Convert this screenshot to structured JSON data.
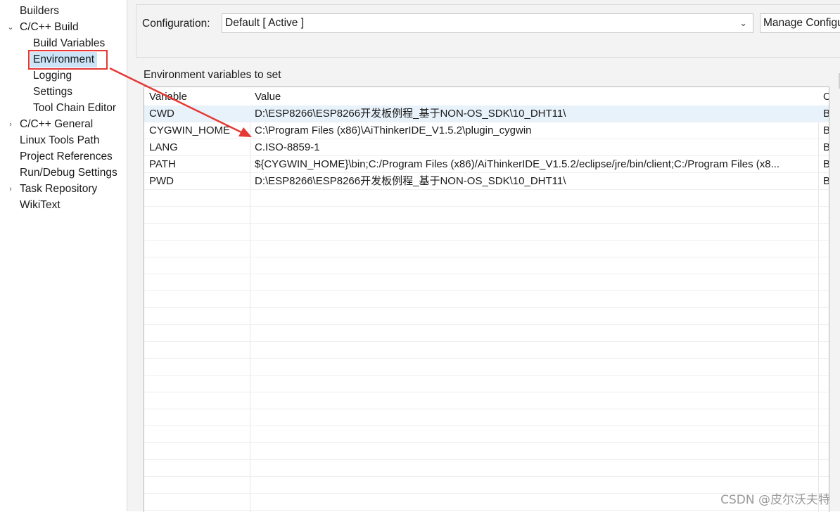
{
  "sidebar": {
    "items": [
      {
        "label": "Builders",
        "twisty": ""
      },
      {
        "label": "C/C++ Build",
        "twisty": "⌄"
      },
      {
        "label": "Build Variables",
        "twisty": ""
      },
      {
        "label": "Environment",
        "twisty": ""
      },
      {
        "label": "Logging",
        "twisty": ""
      },
      {
        "label": "Settings",
        "twisty": ""
      },
      {
        "label": "Tool Chain Editor",
        "twisty": ""
      },
      {
        "label": "C/C++ General",
        "twisty": "›"
      },
      {
        "label": "Linux Tools Path",
        "twisty": ""
      },
      {
        "label": "Project References",
        "twisty": ""
      },
      {
        "label": "Run/Debug Settings",
        "twisty": ""
      },
      {
        "label": "Task Repository",
        "twisty": "›"
      },
      {
        "label": "WikiText",
        "twisty": ""
      }
    ],
    "selected": "Environment"
  },
  "config": {
    "label": "Configuration:",
    "value": "Default  [ Active ]",
    "manage_button": "Manage Configurations..."
  },
  "env": {
    "section_label": "Environment variables to set",
    "columns": [
      "Variable",
      "Value",
      "Origin"
    ],
    "rows": [
      {
        "variable": "CWD",
        "value": "D:\\ESP8266\\ESP8266开发板例程_基于NON-OS_SDK\\10_DHT11\\",
        "origin": "BUILD SYSTEM"
      },
      {
        "variable": "CYGWIN_HOME",
        "value": "C:\\Program Files (x86)\\AiThinkerIDE_V1.5.2\\plugin_cygwin",
        "origin": "BUILD SYSTEM"
      },
      {
        "variable": "LANG",
        "value": "C.ISO-8859-1",
        "origin": "BUILD SYSTEM"
      },
      {
        "variable": "PATH",
        "value": "${CYGWIN_HOME}\\bin;C:/Program Files (x86)/AiThinkerIDE_V1.5.2/eclipse/jre/bin/client;C:/Program Files (x8...",
        "origin": "BUILD SYSTEM"
      },
      {
        "variable": "PWD",
        "value": "D:\\ESP8266\\ESP8266开发板例程_基于NON-OS_SDK\\10_DHT11\\",
        "origin": "BUILD SYSTEM"
      }
    ]
  },
  "watermark": "CSDN @皮尔沃夫特",
  "colors": {
    "annotation": "#e53935",
    "selection": "#cce4f7"
  }
}
